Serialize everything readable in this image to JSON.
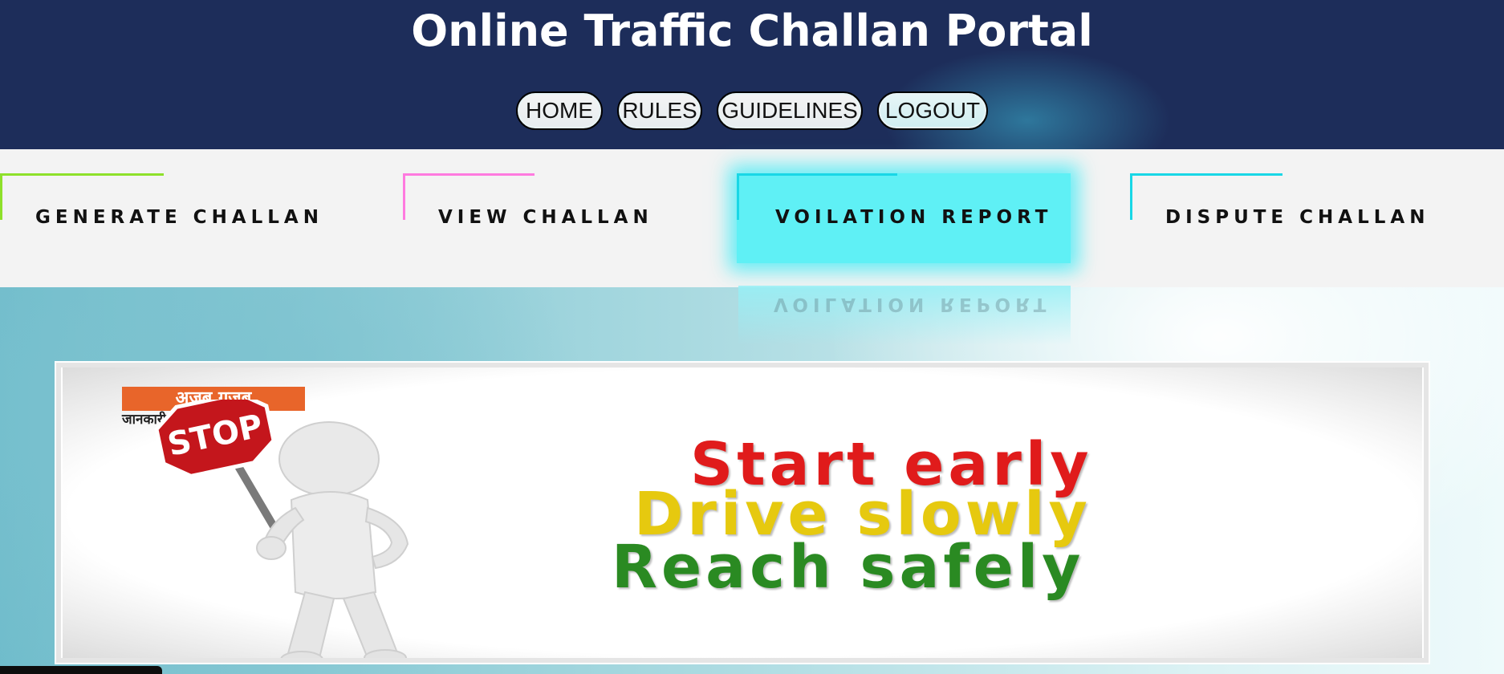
{
  "header": {
    "title": "Online Traffic Challan Portal",
    "nav": [
      {
        "label": "HOME"
      },
      {
        "label": "RULES"
      },
      {
        "label": "GUIDELINES"
      },
      {
        "label": "LOGOUT"
      }
    ],
    "background": "#1d2d5a"
  },
  "menu": {
    "items": [
      {
        "label": "GENERATE CHALLAN",
        "accent": "#8ee02a"
      },
      {
        "label": "VIEW CHALLAN",
        "accent": "#ff7adf"
      },
      {
        "label": "VOILATION REPORT",
        "accent": "#19d7e6",
        "active": true
      },
      {
        "label": "DISPUTE CHALLAN",
        "accent": "#19d7e6"
      }
    ],
    "active_color": "#5ff0f5"
  },
  "carousel": {
    "prev_icon": "chevron-left",
    "banner": {
      "logo_text": "अजब गजब",
      "logo_subtext": "जानकारी",
      "sign_text": "STOP",
      "slogan": [
        {
          "text": "Start early",
          "color": "#e01b1b"
        },
        {
          "text": "Drive slowly",
          "color": "#e6c90f"
        },
        {
          "text": "Reach safely",
          "color": "#2a8a22"
        }
      ]
    }
  }
}
